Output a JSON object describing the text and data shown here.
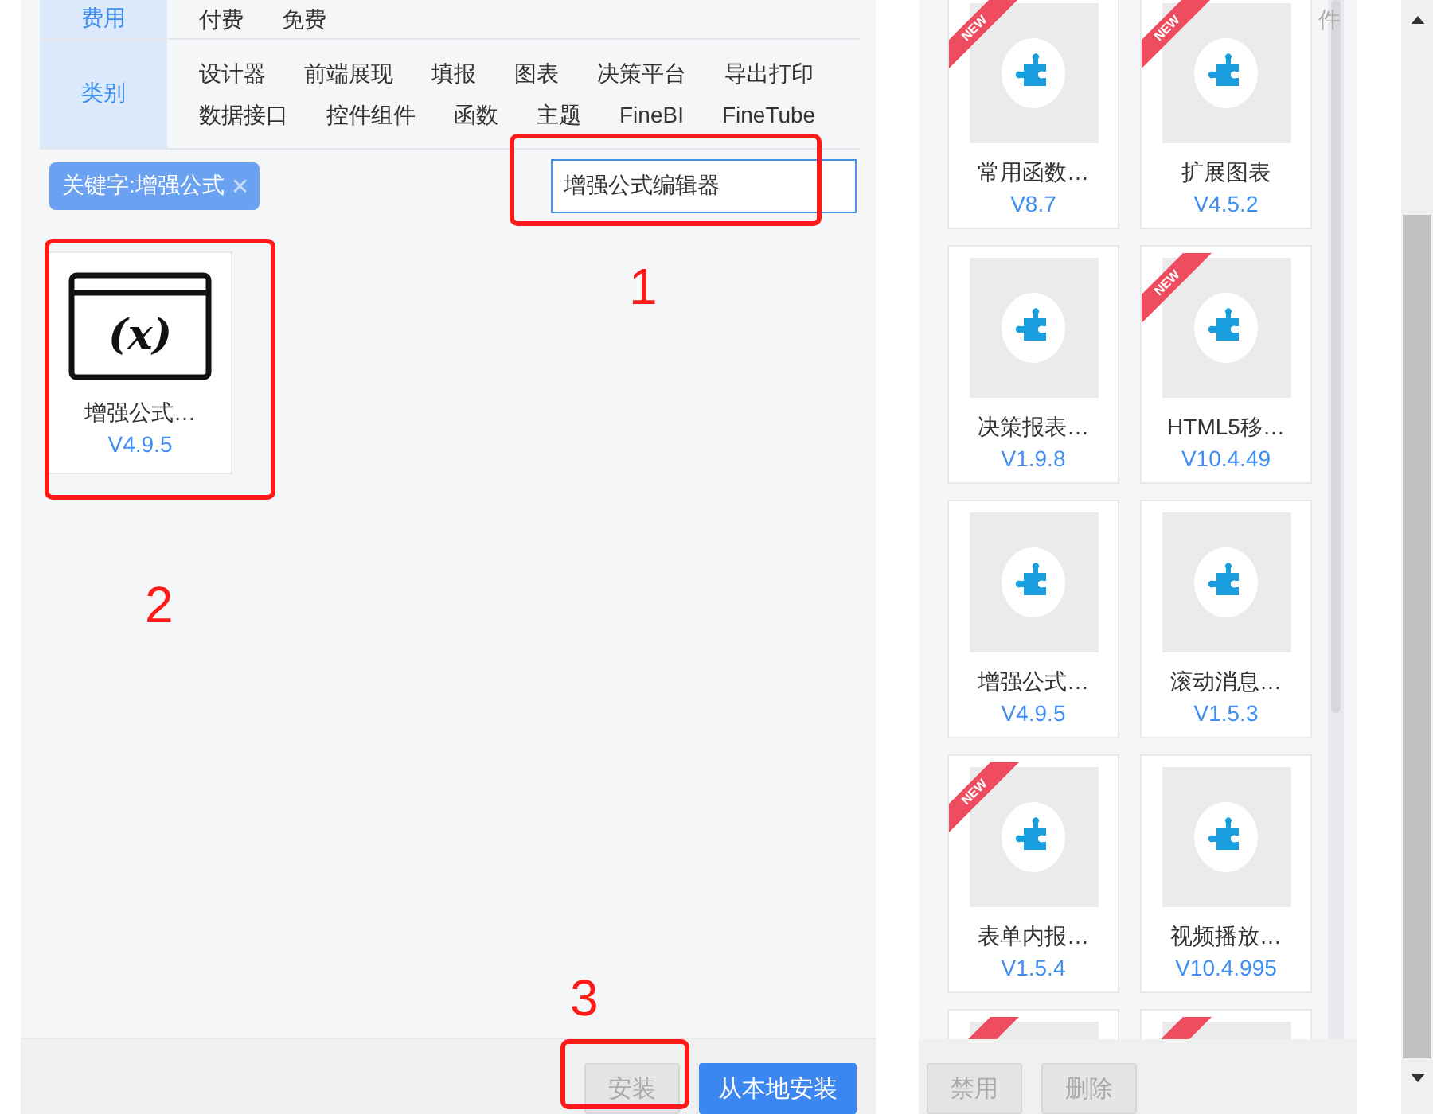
{
  "filters": [
    {
      "label": "费用",
      "options": [
        "付费",
        "免费"
      ]
    },
    {
      "label": "类别",
      "options": [
        "设计器",
        "前端展现",
        "填报",
        "图表",
        "决策平台",
        "导出打印",
        "数据接口",
        "控件组件",
        "函数",
        "主题",
        "FineBI",
        "FineTube"
      ]
    }
  ],
  "keyword_tag": {
    "label": "关键字:增强公式",
    "close": "✕"
  },
  "search": {
    "value": "增强公式编辑器"
  },
  "results": [
    {
      "icon_text": "(x)",
      "name": "增强公式…",
      "version": "V4.9.5"
    }
  ],
  "buttons": [
    {
      "label": "安装",
      "disabled": true
    },
    {
      "label": "从本地安装",
      "disabled": false
    }
  ],
  "annotations": [
    "1",
    "2",
    "3"
  ],
  "installed": {
    "corner_text": "件",
    "cards": [
      {
        "name": "常用函数…",
        "version": "V8.7",
        "new": true,
        "ribbon": "NEW"
      },
      {
        "name": "扩展图表",
        "version": "V4.5.2",
        "new": true,
        "ribbon": "NEW"
      },
      {
        "name": "决策报表…",
        "version": "V1.9.8",
        "new": false
      },
      {
        "name": "HTML5移…",
        "version": "V10.4.49",
        "new": true,
        "ribbon": "NEW"
      },
      {
        "name": "增强公式…",
        "version": "V4.9.5",
        "new": false
      },
      {
        "name": "滚动消息…",
        "version": "V1.5.3",
        "new": false
      },
      {
        "name": "表单内报…",
        "version": "V1.5.4",
        "new": true,
        "ribbon": "NEW"
      },
      {
        "name": "视频播放…",
        "version": "V10.4.995",
        "new": false
      },
      {
        "new": true
      },
      {
        "new": true
      }
    ],
    "buttons": [
      {
        "label": "禁用",
        "disabled": true
      },
      {
        "label": "删除",
        "disabled": true
      }
    ]
  }
}
